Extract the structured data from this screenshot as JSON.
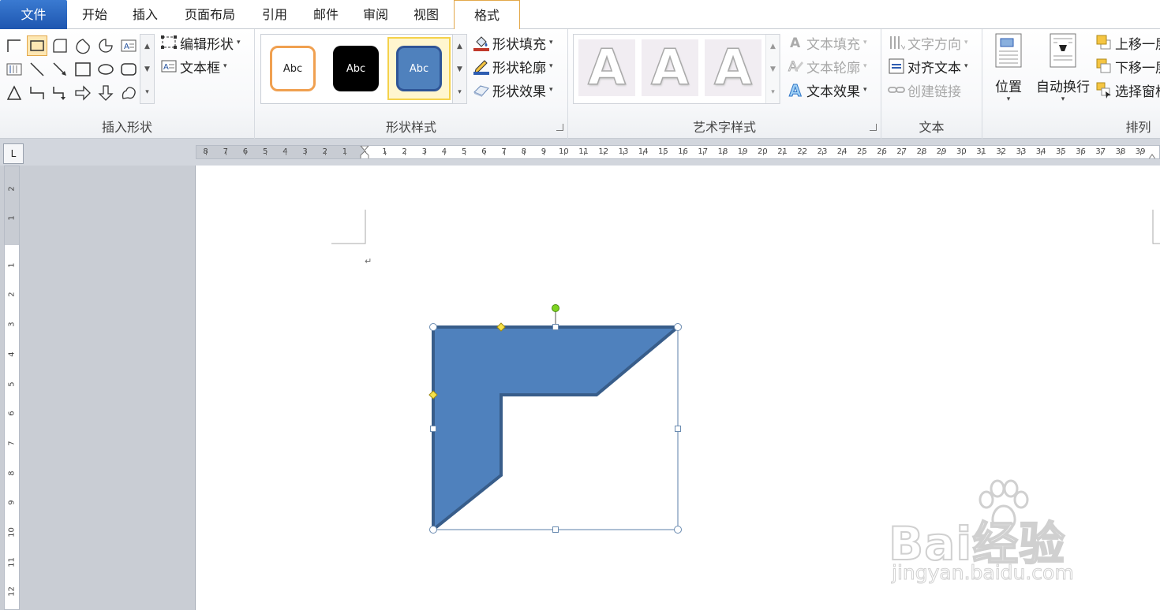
{
  "tabs": [
    {
      "id": "file",
      "label": "文件"
    },
    {
      "id": "home",
      "label": "开始"
    },
    {
      "id": "insert",
      "label": "插入"
    },
    {
      "id": "layout",
      "label": "页面布局"
    },
    {
      "id": "references",
      "label": "引用"
    },
    {
      "id": "mailings",
      "label": "邮件"
    },
    {
      "id": "review",
      "label": "审阅"
    },
    {
      "id": "view",
      "label": "视图"
    },
    {
      "id": "format",
      "label": "格式",
      "active": true
    }
  ],
  "ribbon": {
    "insert_shapes": {
      "label": "插入形状",
      "edit_shape": "编辑形状",
      "text_box": "文本框"
    },
    "shape_styles": {
      "label": "形状样式",
      "thumb_text": "Abc",
      "fill": "形状填充",
      "outline": "形状轮廓",
      "effects": "形状效果",
      "thumbs": [
        {
          "border": "#f0a050",
          "fill": "#ffffff",
          "text_color": "#222222"
        },
        {
          "border": "#000000",
          "fill": "#000000",
          "text_color": "#ffffff"
        },
        {
          "border": "#2f5597",
          "fill": "#4f81bd",
          "text_color": "#ffffff",
          "selected": true
        }
      ]
    },
    "wordart_styles": {
      "label": "艺术字样式",
      "letter": "A",
      "text_fill": "文本填充",
      "text_outline": "文本轮廓",
      "text_effects": "文本效果"
    },
    "text": {
      "label": "文本",
      "direction": "文字方向",
      "align": "对齐文本",
      "link": "创建链接"
    },
    "arrange": {
      "label": "排列",
      "position": "位置",
      "wrap": "自动换行",
      "bring_forward": "上移一层",
      "send_backward": "下移一层",
      "selection_pane": "选择窗格"
    }
  },
  "ruler": {
    "corner_symbol": "L",
    "h_left_numbers": [
      "8",
      "7",
      "6",
      "5",
      "4",
      "3",
      "2",
      "1"
    ],
    "h_right_numbers": [
      "1",
      "2",
      "3",
      "4",
      "5",
      "6",
      "7",
      "8",
      "9",
      "10",
      "11",
      "12",
      "13",
      "14",
      "15",
      "16",
      "17",
      "18",
      "19",
      "20",
      "21",
      "22",
      "23",
      "24",
      "25",
      "26",
      "27",
      "28",
      "29",
      "30",
      "31",
      "32",
      "33",
      "34",
      "35",
      "36",
      "37",
      "38",
      "39"
    ],
    "v_top_numbers": [
      "2",
      "1"
    ],
    "v_numbers": [
      "1",
      "2",
      "3",
      "4",
      "5",
      "6",
      "7",
      "8",
      "9",
      "10",
      "11",
      "12"
    ]
  },
  "document": {
    "paragraph_mark": "↵",
    "shape": {
      "fill": "#4f81bd",
      "outline": "#385d8a",
      "type": "L-shape"
    },
    "watermark": {
      "brand": "Bai经验",
      "url": "jingyan.baidu.com"
    }
  }
}
